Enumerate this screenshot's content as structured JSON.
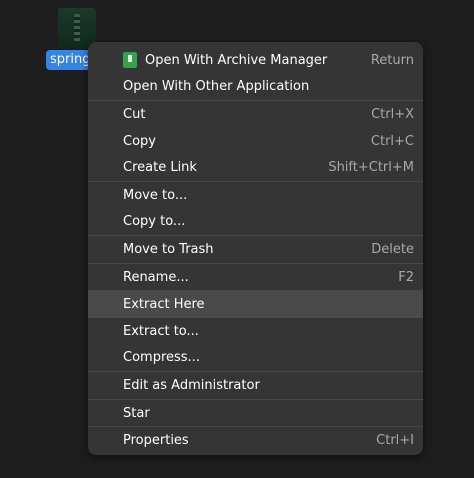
{
  "desktop": {
    "file_label": "spring.",
    "file_icon": "zip-archive-icon"
  },
  "menu": {
    "items": [
      {
        "label": "Open With Archive Manager",
        "shortcut": "Return",
        "icon": "archive-manager-icon"
      },
      {
        "label": "Open With Other Application",
        "shortcut": ""
      },
      {
        "label": "Cut",
        "shortcut": "Ctrl+X"
      },
      {
        "label": "Copy",
        "shortcut": "Ctrl+C"
      },
      {
        "label": "Create Link",
        "shortcut": "Shift+Ctrl+M"
      },
      {
        "label": "Move to...",
        "shortcut": ""
      },
      {
        "label": "Copy to...",
        "shortcut": ""
      },
      {
        "label": "Move to Trash",
        "shortcut": "Delete"
      },
      {
        "label": "Rename...",
        "shortcut": "F2"
      },
      {
        "label": "Extract Here",
        "shortcut": "",
        "highlighted": true
      },
      {
        "label": "Extract to...",
        "shortcut": ""
      },
      {
        "label": "Compress...",
        "shortcut": ""
      },
      {
        "label": "Edit as Administrator",
        "shortcut": ""
      },
      {
        "label": "Star",
        "shortcut": ""
      },
      {
        "label": "Properties",
        "shortcut": "Ctrl+I"
      }
    ]
  },
  "colors": {
    "background": "#1e1e1e",
    "menu_background": "#353535",
    "highlight": "#4a4a4a",
    "selection": "#3584e4",
    "icon_green": "#33a24a"
  }
}
